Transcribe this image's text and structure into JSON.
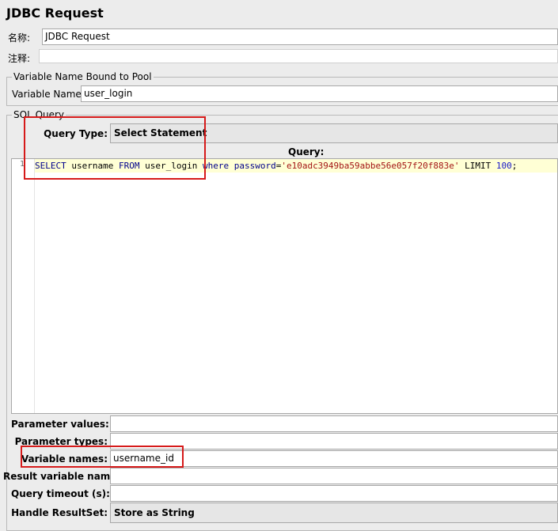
{
  "window": {
    "title": "JDBC Request"
  },
  "name_row": {
    "label": "名称:",
    "value": "JDBC Request"
  },
  "comment_row": {
    "label": "注释:",
    "value": ""
  },
  "pool_group": {
    "legend": "Variable Name Bound to Pool",
    "var_label": "Variable Name:",
    "var_value": "user_login"
  },
  "sql_group": {
    "legend": "SQL Query",
    "query_type_label": "Query Type:",
    "query_type_value": "Select Statement",
    "query_header": "Query:",
    "line_number": "1",
    "sql": {
      "kw_select": "SELECT",
      "t1": " username ",
      "kw_from": "FROM",
      "t2": " user_login ",
      "kw_where": "where",
      "t3": " ",
      "kw_password": "password",
      "t4": "=",
      "string": "'e10adc3949ba59abbe56e057f20f883e'",
      "t5": " LIMIT ",
      "number": "100",
      "t6": ";"
    }
  },
  "params": {
    "parameter_values": {
      "label": "Parameter values:",
      "value": ""
    },
    "parameter_types": {
      "label": "Parameter types:",
      "value": ""
    },
    "variable_names": {
      "label": "Variable names:",
      "value": "username_id"
    },
    "result_variable_name": {
      "label": "Result variable name:",
      "value": ""
    },
    "query_timeout": {
      "label": "Query timeout (s):",
      "value": ""
    },
    "handle_resultset": {
      "label": "Handle ResultSet:",
      "value": "Store as String"
    }
  },
  "highlight_color": "#d61a1a"
}
